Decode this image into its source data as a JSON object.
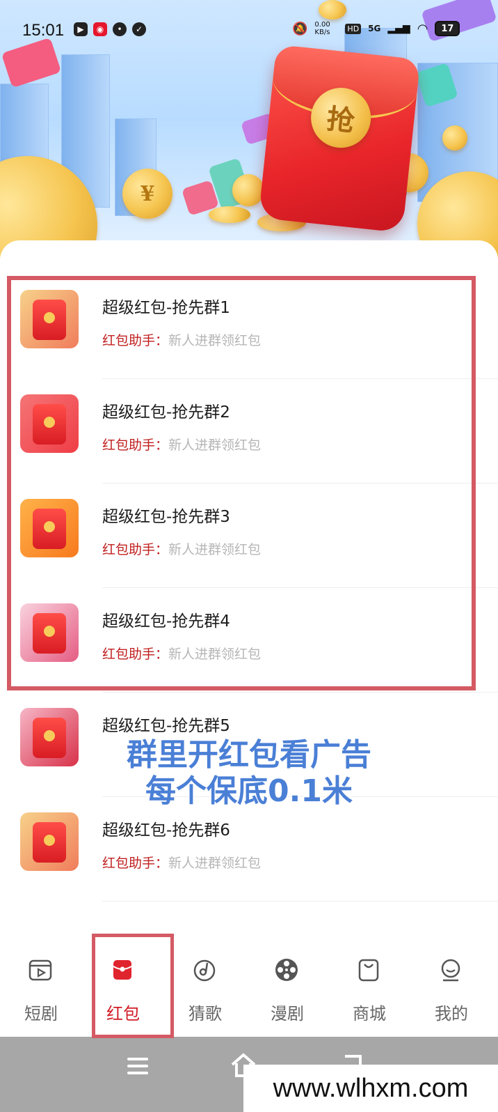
{
  "status_bar": {
    "time": "15:01",
    "net_speed": "0.00 KB/s",
    "hd": "HD",
    "network": "5G",
    "battery": "17"
  },
  "banner": {
    "seal_char": "抢",
    "coin_char": "¥"
  },
  "groups": [
    {
      "title": "超级红包-抢先群1",
      "sender": "红包助手",
      "message": "新人进群领红包"
    },
    {
      "title": "超级红包-抢先群2",
      "sender": "红包助手",
      "message": "新人进群领红包"
    },
    {
      "title": "超级红包-抢先群3",
      "sender": "红包助手",
      "message": "新人进群领红包"
    },
    {
      "title": "超级红包-抢先群4",
      "sender": "红包助手",
      "message": "新人进群领红包"
    },
    {
      "title": "超级红包-抢先群5",
      "sender": "",
      "message": ""
    },
    {
      "title": "超级红包-抢先群6",
      "sender": "红包助手",
      "message": "新人进群领红包"
    }
  ],
  "overlay": {
    "line1": "群里开红包看广告",
    "line2": "每个保底0.1米"
  },
  "nav": {
    "items": [
      {
        "label": "短剧",
        "icon": "video-icon"
      },
      {
        "label": "红包",
        "icon": "red-envelope-icon",
        "active": true
      },
      {
        "label": "猜歌",
        "icon": "music-disc-icon"
      },
      {
        "label": "漫剧",
        "icon": "film-reel-icon"
      },
      {
        "label": "商城",
        "icon": "shopping-bag-icon"
      },
      {
        "label": "我的",
        "icon": "profile-icon"
      }
    ]
  },
  "watermark": "www.wlhxm.com",
  "colors": {
    "accent_red": "#d11c26",
    "highlight_border": "#d45a64",
    "overlay_text": "#4a7fd6"
  }
}
